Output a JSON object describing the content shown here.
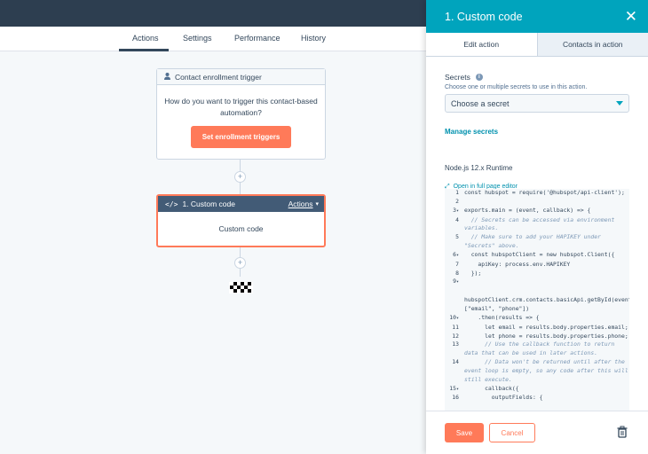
{
  "nav": {
    "tabs": [
      {
        "label": "Actions",
        "active": true
      },
      {
        "label": "Settings",
        "active": false
      },
      {
        "label": "Performance",
        "active": false
      },
      {
        "label": "History",
        "active": false
      }
    ]
  },
  "workflow": {
    "trigger": {
      "header": "Contact enrollment trigger",
      "body_line1": "How do you want to trigger this contact-based",
      "body_line2": "automation?",
      "button": "Set enrollment triggers"
    },
    "action": {
      "header": "1. Custom code",
      "menu": "Actions",
      "body": "Custom code"
    },
    "add_symbol": "+"
  },
  "panel": {
    "title": "1. Custom code",
    "tabs": [
      {
        "label": "Edit action",
        "active": true
      },
      {
        "label": "Contacts in action",
        "active": false
      }
    ],
    "secrets_label": "Secrets",
    "secrets_help": "Choose one or multiple secrets to use in this action.",
    "select_placeholder": "Choose a secret",
    "manage_link": "Manage secrets",
    "runtime": "Node.js 12.x Runtime",
    "open_editor": "Open in full page editor",
    "code": [
      {
        "n": "1",
        "fold": "",
        "text": "const hubspot = require('@hubspot/api-client');"
      },
      {
        "n": "2",
        "fold": "",
        "text": ""
      },
      {
        "n": "3",
        "fold": "▾",
        "text": "exports.main = (event, callback) => {"
      },
      {
        "n": "4",
        "fold": "",
        "text": "  // Secrets can be accessed via environment variables."
      },
      {
        "n": "5",
        "fold": "",
        "text": "  // Make sure to add your HAPIKEY under \"Secrets\" above."
      },
      {
        "n": "6",
        "fold": "▾",
        "text": "  const hubspotClient = new hubspot.Client({"
      },
      {
        "n": "7",
        "fold": "",
        "text": "    apiKey: process.env.HAPIKEY"
      },
      {
        "n": "8",
        "fold": "",
        "text": "  });"
      },
      {
        "n": "9",
        "fold": "▾",
        "text": ""
      },
      {
        "n": "",
        "fold": "",
        "text": "  hubspotClient.crm.contacts.basicApi.getById(event.object.objectId, [\"email\", \"phone\"])"
      },
      {
        "n": "10",
        "fold": "▾",
        "text": "    .then(results => {"
      },
      {
        "n": "11",
        "fold": "",
        "text": "      let email = results.body.properties.email;"
      },
      {
        "n": "12",
        "fold": "",
        "text": "      let phone = results.body.properties.phone;"
      },
      {
        "n": "13",
        "fold": "",
        "text": "      // Use the callback function to return data that can be used in later actions."
      },
      {
        "n": "14",
        "fold": "",
        "text": "      // Data won't be returned until after the event loop is empty, so any code after this will still execute."
      },
      {
        "n": "15",
        "fold": "▾",
        "text": "      callback({"
      },
      {
        "n": "16",
        "fold": "",
        "text": "        outputFields: {"
      }
    ],
    "save": "Save",
    "cancel": "Cancel"
  },
  "colors": {
    "accent": "#ff7a59",
    "panel_header": "#00a4bd",
    "dark_header": "#425b76",
    "topbar": "#2d3e50"
  }
}
